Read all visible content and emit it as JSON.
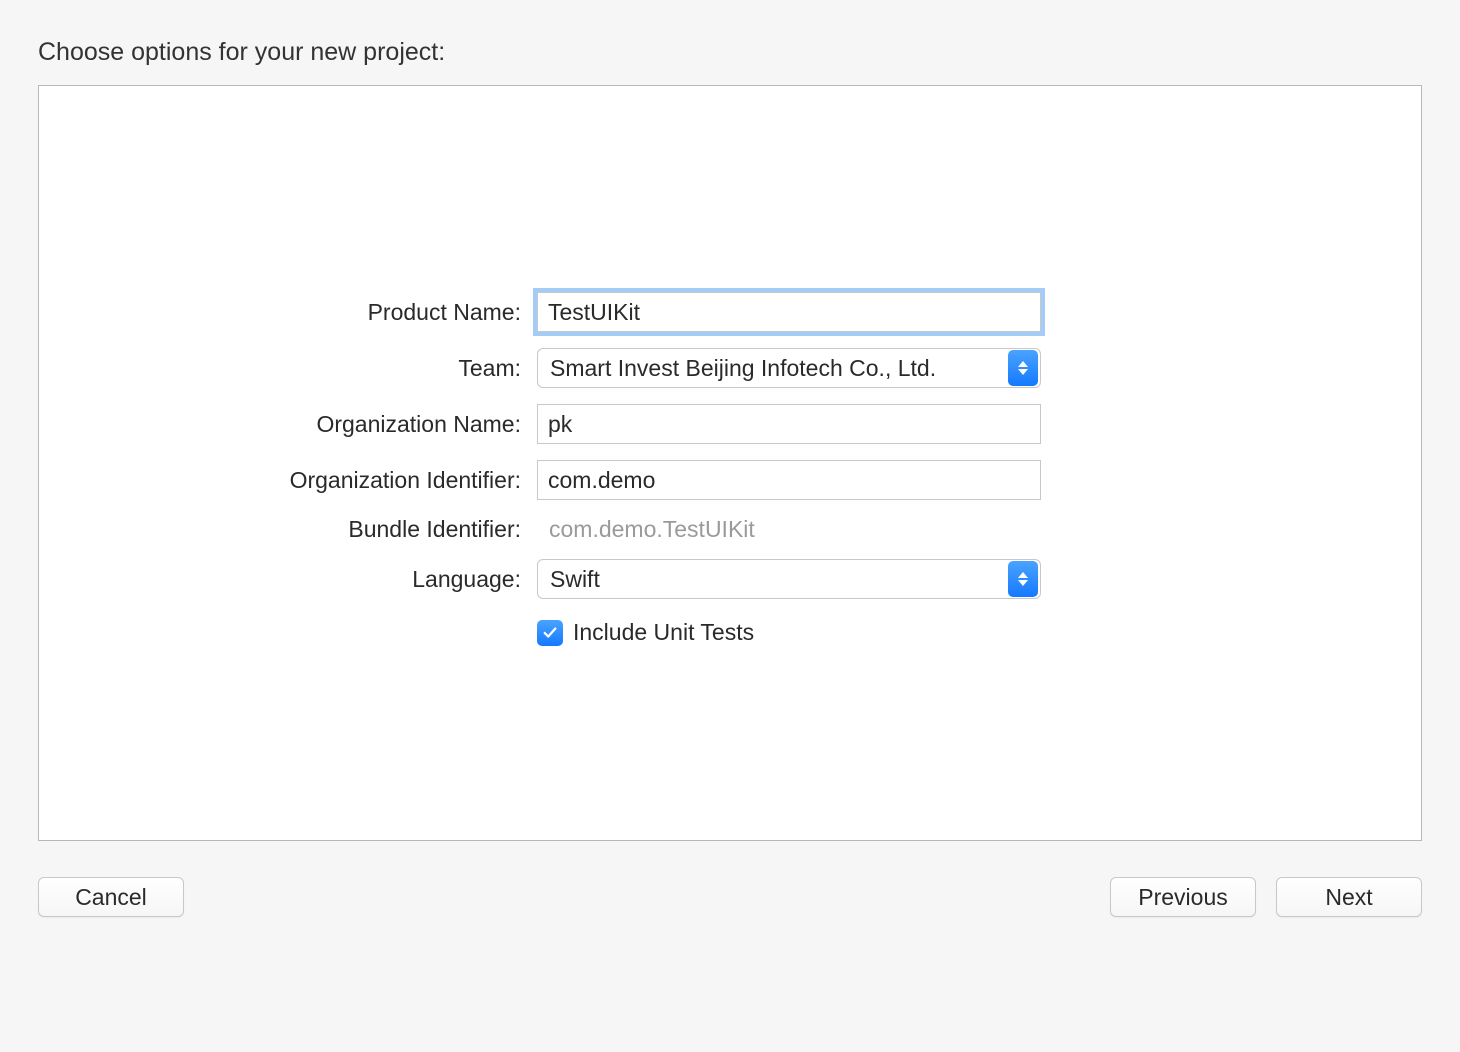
{
  "title": "Choose options for your new project:",
  "form": {
    "productName": {
      "label": "Product Name:",
      "value": "TestUIKit"
    },
    "team": {
      "label": "Team:",
      "value": "Smart Invest Beijing Infotech Co., Ltd."
    },
    "orgName": {
      "label": "Organization Name:",
      "value": "pk"
    },
    "orgIdentifier": {
      "label": "Organization Identifier:",
      "value": "com.demo"
    },
    "bundleIdentifier": {
      "label": "Bundle Identifier:",
      "value": "com.demo.TestUIKit"
    },
    "language": {
      "label": "Language:",
      "value": "Swift"
    },
    "includeUnitTests": {
      "label": "Include Unit Tests",
      "checked": true
    }
  },
  "buttons": {
    "cancel": "Cancel",
    "previous": "Previous",
    "next": "Next"
  }
}
